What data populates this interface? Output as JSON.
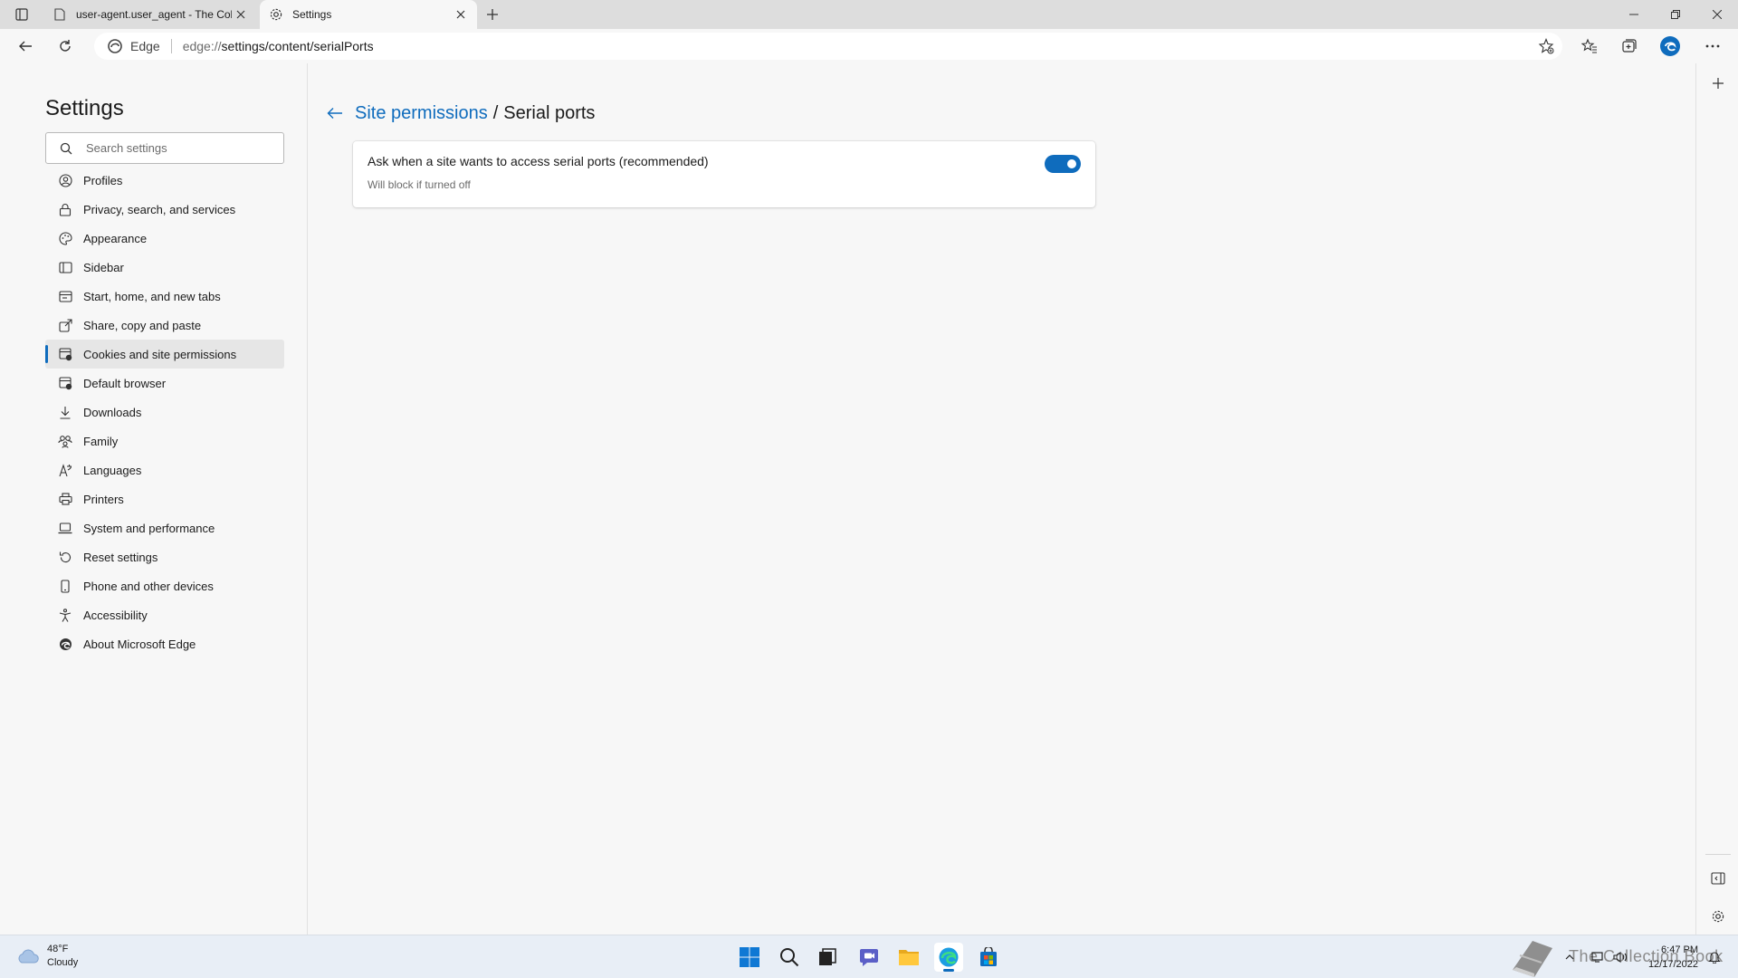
{
  "browser": {
    "tabs": [
      {
        "title": "user-agent.user_agent - The Coll",
        "active": false
      },
      {
        "title": "Settings",
        "active": true
      }
    ],
    "address": {
      "label": "Edge",
      "url_prefix": "edge://",
      "url_path": "settings/content/serialPorts"
    }
  },
  "sidebar": {
    "title": "Settings",
    "search_placeholder": "Search settings",
    "items": [
      {
        "label": "Profiles",
        "icon": "profile-icon"
      },
      {
        "label": "Privacy, search, and services",
        "icon": "lock-icon"
      },
      {
        "label": "Appearance",
        "icon": "palette-icon"
      },
      {
        "label": "Sidebar",
        "icon": "sidebar-icon"
      },
      {
        "label": "Start, home, and new tabs",
        "icon": "home-tab-icon"
      },
      {
        "label": "Share, copy and paste",
        "icon": "share-icon"
      },
      {
        "label": "Cookies and site permissions",
        "icon": "cookies-icon",
        "active": true
      },
      {
        "label": "Default browser",
        "icon": "default-browser-icon"
      },
      {
        "label": "Downloads",
        "icon": "download-icon"
      },
      {
        "label": "Family",
        "icon": "family-icon"
      },
      {
        "label": "Languages",
        "icon": "languages-icon"
      },
      {
        "label": "Printers",
        "icon": "printer-icon"
      },
      {
        "label": "System and performance",
        "icon": "laptop-icon"
      },
      {
        "label": "Reset settings",
        "icon": "reset-icon"
      },
      {
        "label": "Phone and other devices",
        "icon": "phone-icon"
      },
      {
        "label": "Accessibility",
        "icon": "accessibility-icon"
      },
      {
        "label": "About Microsoft Edge",
        "icon": "edge-icon"
      }
    ]
  },
  "main": {
    "breadcrumb_parent": "Site permissions",
    "breadcrumb_separator": "/",
    "breadcrumb_current": "Serial ports",
    "setting": {
      "title": "Ask when a site wants to access serial ports (recommended)",
      "subtitle": "Will block if turned off",
      "enabled": true
    }
  },
  "taskbar": {
    "weather_temp": "48°F",
    "weather_desc": "Cloudy",
    "tray_text": "The Collection Book",
    "time": "6:47 PM",
    "date": "12/17/2022"
  },
  "colors": {
    "accent": "#0f6cbd",
    "page_bg": "#f7f7f7",
    "tabstrip_bg": "#dddddd"
  }
}
